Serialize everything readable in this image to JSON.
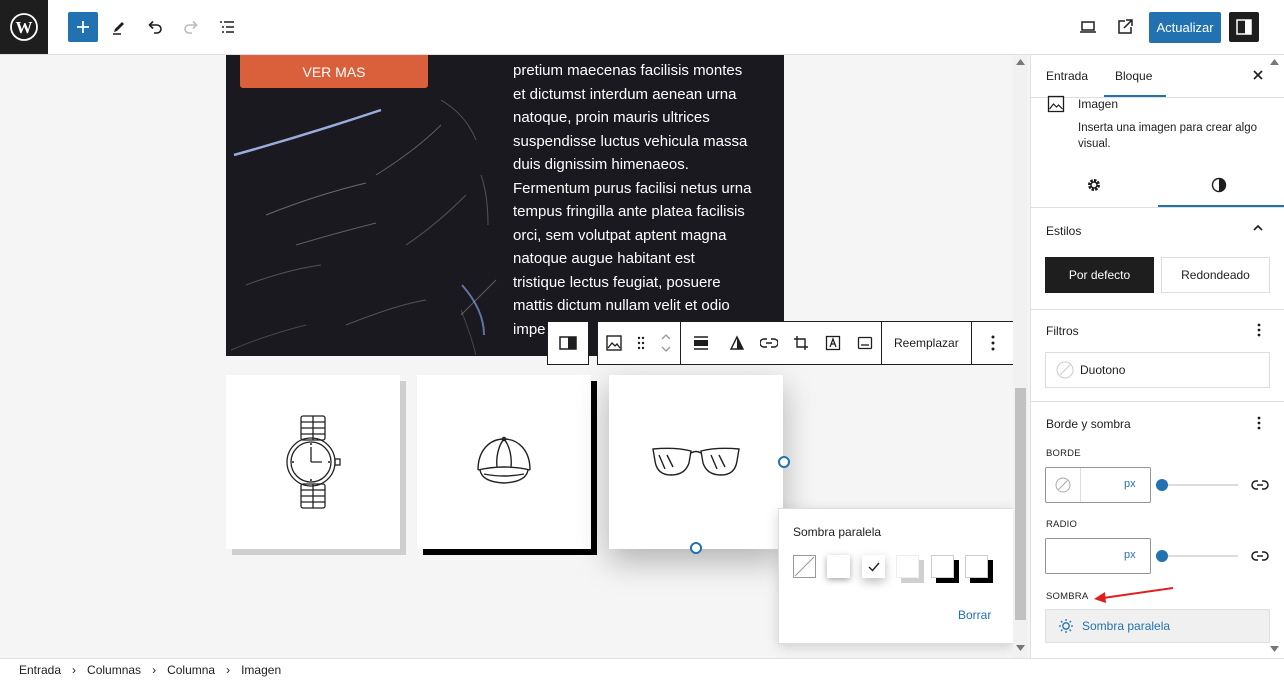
{
  "topbar": {
    "update_label": "Actualizar"
  },
  "canvas": {
    "cover": {
      "button_label": "VER MAS",
      "paragraph_lines": [
        "pretium maecenas facilisis montes",
        "et dictumst interdum aenean urna",
        "natoque, proin mauris ultrices",
        "suspendisse luctus vehicula massa",
        "duis dignissim himenaeos.",
        "Fermentum purus facilisi netus urna",
        "tempus fringilla ante platea facilisis",
        "orci, sem volutpat aptent magna",
        "natoque augue habitant est",
        "tristique lectus feugiat, posuere",
        "mattis dictum nullam velit et odio",
        "impe"
      ]
    },
    "gallery": [
      {
        "icon": "wristwatch-icon"
      },
      {
        "icon": "baseball-cap-icon"
      },
      {
        "icon": "sunglasses-icon"
      }
    ],
    "block_toolbar": {
      "replace_label": "Reemplazar"
    },
    "shadow_popover": {
      "title": "Sombra paralela",
      "clear_label": "Borrar",
      "selected_index": 2
    }
  },
  "breadcrumb": [
    "Entrada",
    "Columnas",
    "Columna",
    "Imagen"
  ],
  "sidebar": {
    "tabs": [
      "Entrada",
      "Bloque"
    ],
    "active_tab": "Bloque",
    "block": {
      "name": "Imagen",
      "description_lines": [
        "Inserta una imagen para crear algo",
        "visual."
      ]
    },
    "styles": {
      "title": "Estilos",
      "options": [
        "Por defecto",
        "Redondeado"
      ],
      "selected": "Por defecto"
    },
    "filters": {
      "title": "Filtros",
      "duotone_label": "Duotono"
    },
    "border_shadow": {
      "title": "Borde y sombra",
      "border_label": "BORDE",
      "border_unit": "px",
      "radius_label": "RADIO",
      "radius_unit": "px",
      "shadow_label": "SOMBRA",
      "shadow_value": "Sombra paralela"
    }
  },
  "colors": {
    "accent": "#2271b1",
    "ver_mas_button": "#d9603b",
    "annotation_arrow": "#e02020"
  }
}
